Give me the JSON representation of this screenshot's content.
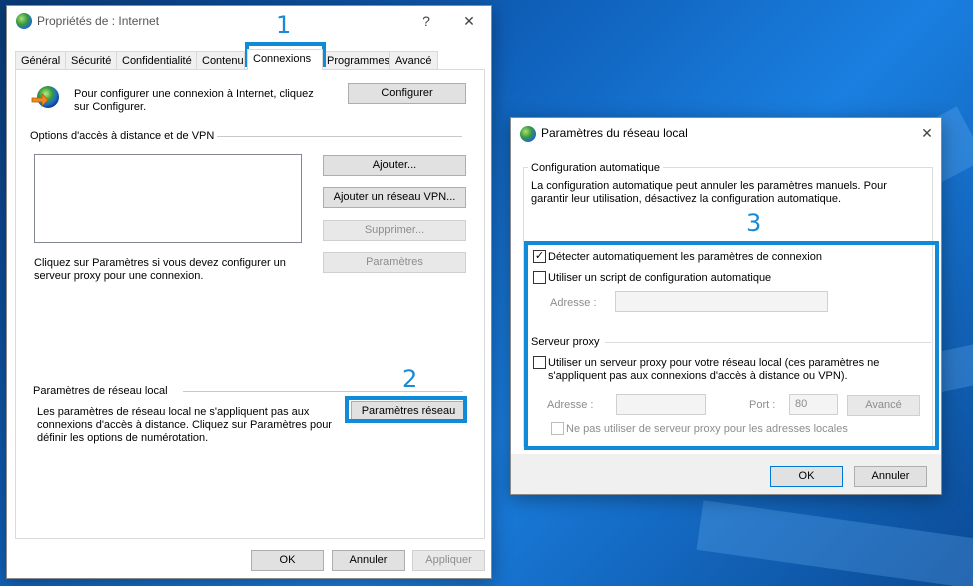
{
  "desktop": {},
  "internet_props": {
    "title": "Propriétés de : Internet",
    "help": "?",
    "close": "✕",
    "tabs": [
      "Général",
      "Sécurité",
      "Confidentialité",
      "Contenu",
      "Connexions",
      "Programmes",
      "Avancé"
    ],
    "setup_text_1": "Pour configurer une connexion à Internet, cliquez",
    "setup_text_2": "sur Configurer.",
    "configure_btn": "Configurer",
    "vpn_section": "Options d'accès à distance et de VPN",
    "add_btn": "Ajouter...",
    "add_vpn_btn": "Ajouter un réseau VPN...",
    "remove_btn": "Supprimer...",
    "settings_btn": "Paramètres",
    "proxy_text_1": "Cliquez sur Paramètres si vous devez configurer un",
    "proxy_text_2": "serveur proxy pour une connexion.",
    "lan_section": "Paramètres de réseau local",
    "lan_text_1": "Les paramètres de réseau local ne s'appliquent pas aux",
    "lan_text_2": "connexions d'accès à distance. Cliquez sur Paramètres pour",
    "lan_text_3": "définir les options de numérotation.",
    "lan_btn": "Paramètres réseau",
    "ok": "OK",
    "cancel": "Annuler",
    "apply": "Appliquer"
  },
  "lan_dialog": {
    "title": "Paramètres du réseau local",
    "close": "✕",
    "auto_group": "Configuration automatique",
    "auto_text_1": "La configuration automatique peut annuler les paramètres manuels. Pour",
    "auto_text_2": "garantir leur utilisation, désactivez la configuration automatique.",
    "detect_label": "Détecter automatiquement les paramètres de connexion",
    "detect_checked": true,
    "script_label": "Utiliser un script de configuration automatique",
    "script_checked": false,
    "address_label": "Adresse :",
    "address_value": "",
    "proxy_group": "Serveur proxy",
    "proxy_label_1": "Utiliser un serveur proxy pour votre réseau local (ces paramètres ne",
    "proxy_label_2": "s'appliquent pas aux connexions d'accès à distance ou VPN).",
    "proxy_checked": false,
    "proxy_address_label": "Adresse :",
    "port_label": "Port :",
    "port_value": "80",
    "advanced_btn": "Avancé",
    "bypass_label": "Ne pas utiliser de serveur proxy pour les adresses locales",
    "ok": "OK",
    "cancel": "Annuler"
  },
  "annotations": [
    "1",
    "2",
    "3"
  ],
  "colors": {
    "highlight": "#0f8bd8",
    "accent": "#0078d7"
  }
}
